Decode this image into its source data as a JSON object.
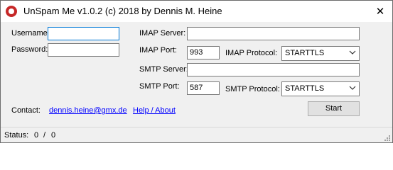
{
  "window": {
    "title": "UnSpam Me v1.0.2 (c) 2018 by Dennis M. Heine",
    "icon": "app-logo-icon",
    "close_glyph": "✕"
  },
  "form": {
    "username_label": "Username:",
    "username_value": "",
    "password_label": "Password:",
    "password_value": "",
    "imap_server_label": "IMAP Server:",
    "imap_server_value": "",
    "imap_port_label": "IMAP Port:",
    "imap_port_value": "993",
    "imap_protocol_label": "IMAP Protocol:",
    "imap_protocol_value": "STARTTLS",
    "smtp_server_label": "SMTP Server:",
    "smtp_server_value": "",
    "smtp_port_label": "SMTP Port:",
    "smtp_port_value": "587",
    "smtp_protocol_label": "SMTP Protocol:",
    "smtp_protocol_value": "STARTTLS"
  },
  "footer": {
    "contact_label": "Contact:",
    "email_link": "dennis.heine@gmx.de",
    "help_link": "Help / About",
    "start_button": "Start"
  },
  "status": {
    "label": "Status:",
    "current": "0",
    "separator": "/",
    "total": "0"
  },
  "colors": {
    "link": "#0000ff",
    "focus_border": "#0078d7",
    "icon_red": "#c62828"
  }
}
